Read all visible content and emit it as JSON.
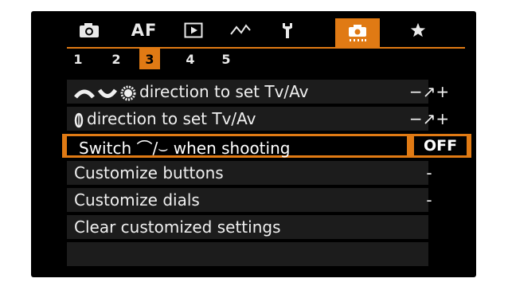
{
  "tabs": [
    {
      "icon": "camera-icon",
      "label": ""
    },
    {
      "icon": "",
      "label": "AF"
    },
    {
      "icon": "playback-icon",
      "label": ""
    },
    {
      "icon": "wireless-icon",
      "label": ""
    },
    {
      "icon": "wrench-icon",
      "label": ""
    },
    {
      "icon": "custom-functions-icon",
      "label": "",
      "active": true
    },
    {
      "icon": "star-icon",
      "label": ""
    }
  ],
  "pages": [
    "1",
    "2",
    "3",
    "4",
    "5"
  ],
  "active_page": "3",
  "menu": {
    "items": [
      {
        "icons": [
          "main-dial-icon",
          "quick-dial-icon",
          "control-ring-icon"
        ],
        "label": "direction to set Tv/Av",
        "value": "−↗+"
      },
      {
        "icons": [
          "control-dial-icon"
        ],
        "label": "direction to set Tv/Av",
        "value": "−↗+"
      },
      {
        "label": "Switch ⌒/⌣ when shooting",
        "value": "OFF",
        "selected": true
      },
      {
        "label": "Customize buttons",
        "value": "-"
      },
      {
        "label": "Customize dials",
        "value": "-"
      },
      {
        "label": "Clear customized settings",
        "value": ""
      }
    ]
  },
  "colors": {
    "accent": "#e07a14",
    "background": "#000000",
    "row": "#1c1c1c",
    "text": "#f0f0f0"
  }
}
